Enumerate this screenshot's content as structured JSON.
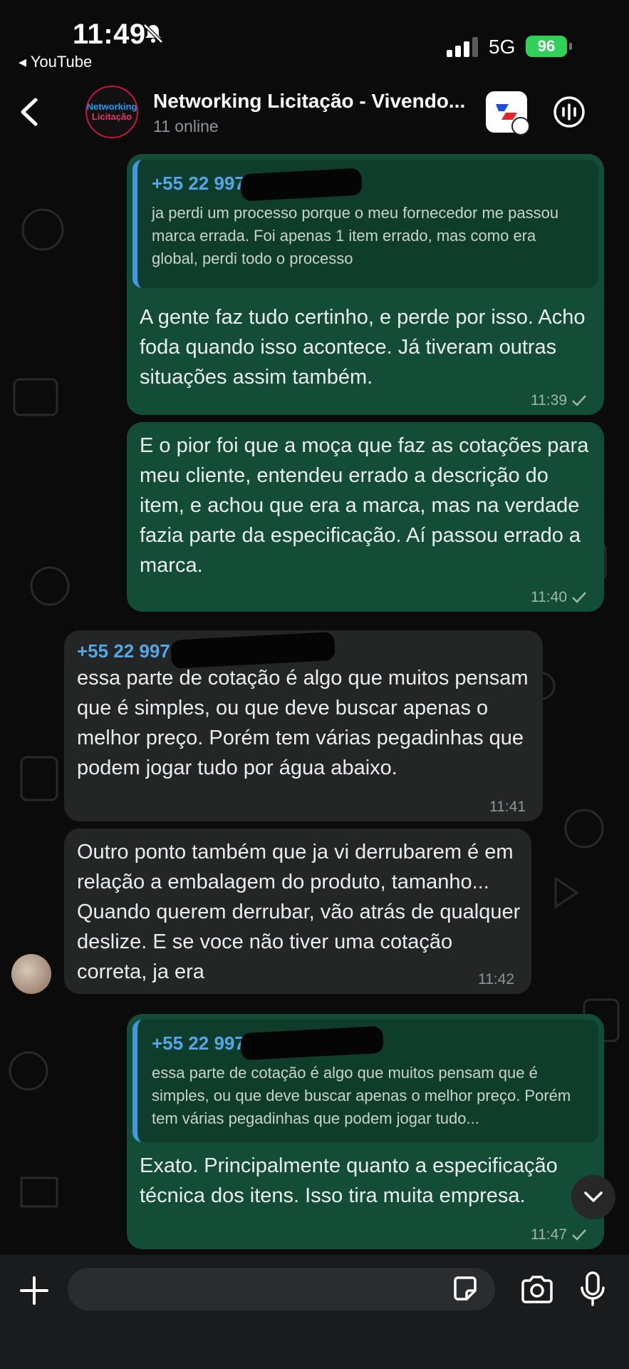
{
  "status_bar": {
    "time": "11:49",
    "back_app": "◂ YouTube",
    "network": "5G",
    "battery": "96"
  },
  "header": {
    "avatar_line1": "Networking",
    "avatar_line2": "Licitação",
    "title": "Networking Licitação - Vivendo...",
    "subtitle": "11 online"
  },
  "messages": [
    {
      "quote_sender": "+55 22 9971",
      "quote_text": "ja perdi um processo porque o meu fornecedor me passou marca errada. Foi apenas 1 item errado, mas como era global, perdi todo o processo",
      "text": "A gente faz tudo certinho, e perde por isso. Acho foda quando isso acontece. Já tiveram outras situações assim também.",
      "time": "11:39"
    },
    {
      "text": "E o pior foi que a moça que faz as cotações para meu cliente, entendeu errado a descrição do item, e achou que era a marca, mas na verdade fazia parte da especificação. Aí passou errado a marca.",
      "time": "11:40"
    },
    {
      "sender": "+55 22 997",
      "text": "essa parte de cotação é algo que muitos pensam que é simples, ou que deve buscar apenas o melhor preço. Porém tem várias pegadinhas que podem jogar tudo por água abaixo.",
      "time": "11:41"
    },
    {
      "text": "Outro ponto também que ja vi derrubarem é em relação a embalagem do produto, tamanho... Quando querem derrubar, vão atrás de qualquer deslize. E se voce não tiver uma cotação correta, ja era",
      "time": "11:42"
    },
    {
      "quote_sender": "+55 22 997",
      "quote_text": "essa parte de cotação é algo que muitos pensam que é simples, ou que deve buscar apenas o melhor preço. Porém tem várias pegadinhas que podem jogar tudo...",
      "text": "Exato. Principalmente quanto a especificação técnica dos itens. Isso tira muita empresa.",
      "time": "11:47"
    }
  ],
  "composer": {
    "placeholder": ""
  },
  "colors": {
    "outgoing_bubble": "#144d37",
    "incoming_bubble": "#242626",
    "quote_accent": "#3f9ae2",
    "battery": "#30d158"
  },
  "icons": [
    "bell-slash-icon",
    "signal-icon",
    "battery-icon",
    "back-chevron-icon",
    "app-icon",
    "call-icon",
    "check-icon",
    "chevron-down-icon",
    "plus-icon",
    "sticker-icon",
    "camera-icon",
    "mic-icon"
  ]
}
